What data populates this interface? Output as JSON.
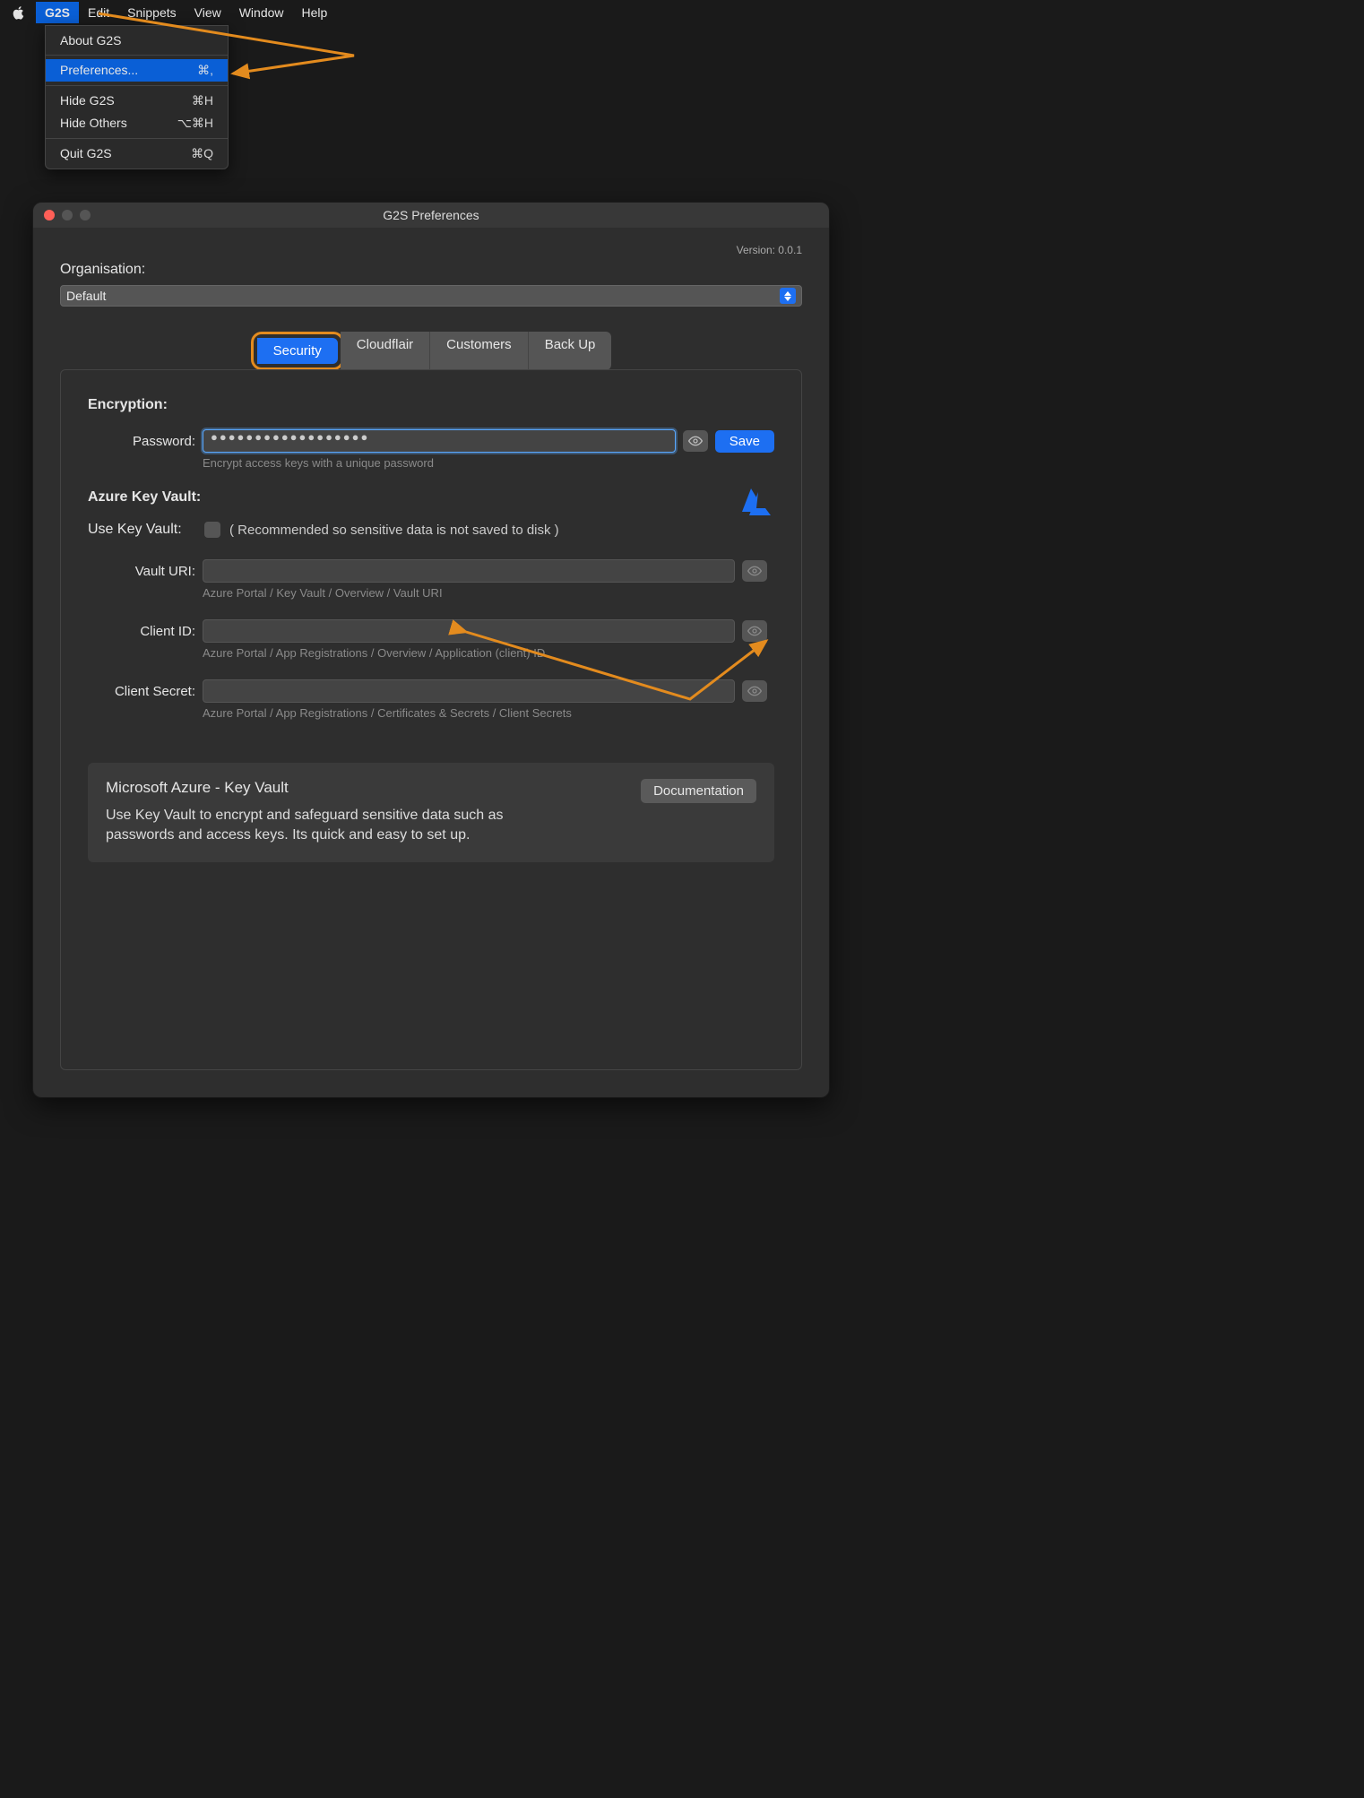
{
  "menubar": {
    "app": "G2S",
    "items": [
      "Edit",
      "Snippets",
      "View",
      "Window",
      "Help"
    ]
  },
  "dropdown": {
    "about": "About G2S",
    "prefs": "Preferences...",
    "prefs_short": "⌘,",
    "hide": "Hide G2S",
    "hide_short": "⌘H",
    "hide_others": "Hide Others",
    "hide_others_short": "⌥⌘H",
    "quit": "Quit G2S",
    "quit_short": "⌘Q"
  },
  "window": {
    "title": "G2S Preferences",
    "version": "Version: 0.0.1"
  },
  "org": {
    "label": "Organisation:",
    "value": "Default"
  },
  "tabs": [
    "Security",
    "Cloudflair",
    "Customers",
    "Back Up"
  ],
  "encryption": {
    "heading": "Encryption:",
    "password_label": "Password:",
    "password_value": "●●●●●●●●●●●●●●●●●●",
    "hint": "Encrypt access keys with a unique password",
    "save": "Save"
  },
  "vault": {
    "heading": "Azure Key Vault:",
    "use_label": "Use Key Vault:",
    "use_note": "( Recommended so sensitive data is not saved to disk )",
    "uri_label": "Vault URI:",
    "uri_hint": "Azure Portal / Key Vault / Overview / Vault URI",
    "client_id_label": "Client ID:",
    "client_id_hint": "Azure Portal / App Registrations / Overview / Application (client) ID",
    "client_secret_label": "Client Secret:",
    "client_secret_hint": "Azure Portal / App Registrations / Certificates & Secrets / Client Secrets"
  },
  "info": {
    "title": "Microsoft Azure - Key Vault",
    "body": "Use Key Vault to encrypt and safeguard sensitive data such as passwords and access keys. Its quick and easy to set up.",
    "doc_btn": "Documentation"
  }
}
